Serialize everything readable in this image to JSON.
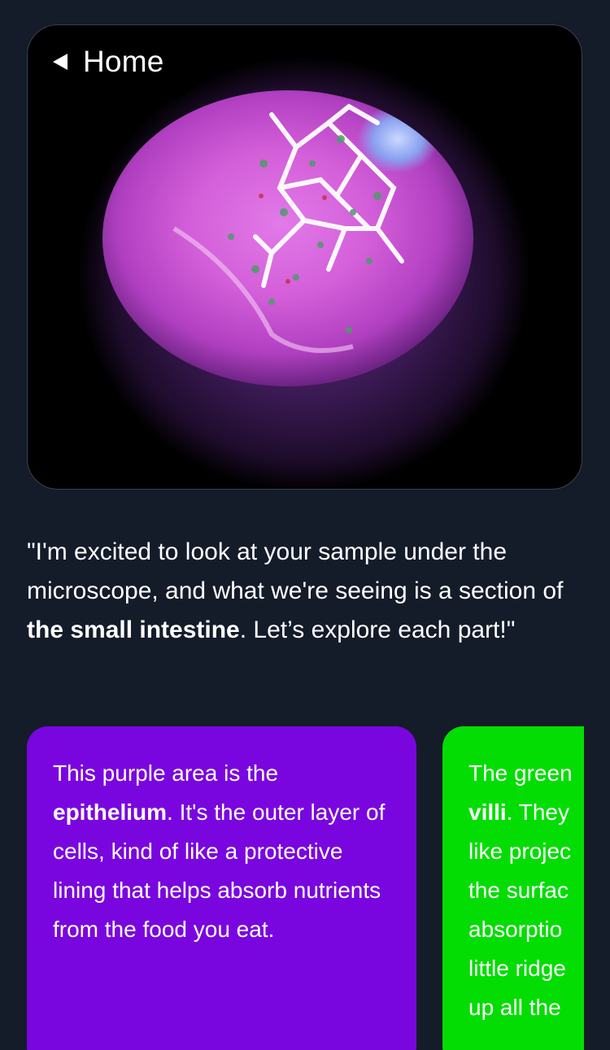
{
  "nav": {
    "back_label": "Home"
  },
  "viewer": {
    "image_alt": "Microscope view of a stained small intestine tissue sample"
  },
  "intro": {
    "before": "\"I'm excited to look at your sample under the microscope, and what we're seeing is a section of ",
    "bold": "the small intestine",
    "after": ". Let’s explore each part!\""
  },
  "cards": [
    {
      "color": "#7a06df",
      "before": "This purple area is the ",
      "bold": "epithelium",
      "after": ". It's the outer layer of cells, kind of like a protective lining that helps absorb nutrients from the food you eat."
    },
    {
      "color": "#04dd04",
      "lines": [
        {
          "before": "The green"
        },
        {
          "bold": "villi",
          "after": ". They"
        },
        {
          "before": "like projec"
        },
        {
          "before": "the surfac"
        },
        {
          "before": "absorptio"
        },
        {
          "before": "little ridge"
        },
        {
          "before": "up all the"
        }
      ]
    }
  ],
  "colors": {
    "background": "#141b29",
    "card_purple": "#7a06df",
    "card_green": "#04dd04"
  }
}
